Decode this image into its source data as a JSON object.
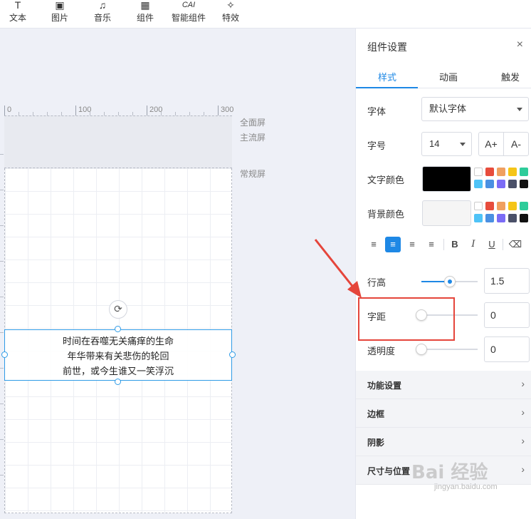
{
  "toolbar": {
    "items": [
      {
        "label": "文本",
        "icon": "T"
      },
      {
        "label": "图片",
        "icon": "▣"
      },
      {
        "label": "音乐",
        "icon": "♫"
      },
      {
        "label": "组件",
        "icon": "▦"
      },
      {
        "label": "智能组件",
        "icon": "CAI"
      },
      {
        "label": "特效",
        "icon": "✧"
      }
    ]
  },
  "canvas": {
    "ruler_labels": [
      "0",
      "100",
      "200",
      "300"
    ],
    "screen_labels": {
      "full": "全面屏",
      "main": "主流屏",
      "normal": "常规屏"
    },
    "text_lines": [
      "时间在吞噬无关痛痒的生命",
      "年华带来有关悲伤的轮回",
      "前世，或今生谁又一笑浮沉"
    ],
    "rotate_icon": "⟳"
  },
  "panel": {
    "title": "组件设置",
    "close_icon": "×",
    "tabs": [
      "样式",
      "动画",
      "触发"
    ],
    "font": {
      "label": "字体",
      "value": "默认字体"
    },
    "size": {
      "label": "字号",
      "value": "14",
      "inc": "A+",
      "dec": "A-"
    },
    "text_color": {
      "label": "文字颜色",
      "value": "#000000"
    },
    "bg_color": {
      "label": "背景颜色",
      "value": "#f5f5f5"
    },
    "palette_row1": [
      "#ffffff",
      "#e74c3c",
      "#f0a060",
      "#f5c518",
      "#2ecc9a"
    ],
    "palette_row2": [
      "#4fc3f7",
      "#4a90e2",
      "#7b6cf6",
      "#4a5068",
      "#111111"
    ],
    "align_buttons": [
      "≡",
      "≡",
      "≡",
      "≡"
    ],
    "style_buttons": [
      "B",
      "I",
      "U",
      "⌫"
    ],
    "line_height": {
      "label": "行高",
      "value": "1.5",
      "level": 0.5
    },
    "letter_spacing": {
      "label": "字距",
      "value": "0",
      "level": 0
    },
    "opacity": {
      "label": "透明度",
      "value": "0",
      "level": 0
    },
    "sections": [
      "功能设置",
      "边框",
      "阴影",
      "尺寸与位置"
    ],
    "chevron": "›"
  },
  "watermark": {
    "main": "Bai 经验",
    "sub": "jingyan.baidu.com"
  }
}
